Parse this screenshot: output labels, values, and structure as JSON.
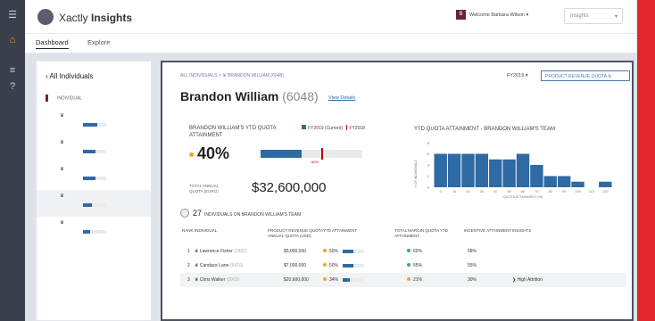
{
  "brand": {
    "name_plain": "Xactly ",
    "name_bold": "Insights"
  },
  "user": {
    "badge": "B",
    "welcome": "Welcome Barbara Wilson ▾"
  },
  "insights_select": {
    "value": "Insights"
  },
  "nav": {
    "tabs": [
      "Dashboard",
      "Explore"
    ]
  },
  "sidebar": {
    "back_label": "All Individuals",
    "header": "INDIVIDUAL",
    "items": [
      {
        "rank": "1",
        "name": "Lawrence Lane",
        "id": "(2001)",
        "pct": "60%",
        "progress": 0.6
      },
      {
        "rank": "2",
        "name": "Barry White",
        "id": "(2013)",
        "pct": "55%",
        "progress": 0.55
      },
      {
        "rank": "3",
        "name": "Crystal Edwards",
        "id": "(1110)",
        "pct": "55%",
        "progress": 0.55
      },
      {
        "rank": "4",
        "name": "Brandon William",
        "id": "(6048)",
        "pct": "40%",
        "progress": 0.4
      },
      {
        "rank": "5",
        "name": "Steve Edward",
        "id": "(2022)",
        "pct": "30%",
        "progress": 0.3
      }
    ]
  },
  "main": {
    "breadcrumb": "ALL INDIVIDUALS  >  ♛  BRANDON WILLIAM (6048)",
    "fy": "FY2019  ▾",
    "quota_button": "PRODUCT REVENUE QUOTA  ⇅",
    "name": "Brandon William ",
    "name_id": "(6048)",
    "view_details": "View Details",
    "attainment_title": "BRANDON WILLIAM'S YTD QUOTA ATTAINMENT",
    "legend_current": "FY2019 (Current)",
    "legend_prev": "FY2018",
    "attainment_value": "40%",
    "attainment_progress": 0.4,
    "target_label": "60%",
    "total_quota_label": "TOTAL ANNUAL QUOTA (EURO)",
    "total_quota_value": "$32,600,000",
    "team_chart_title": "YTD QUOTA ATTAINMENT - BRANDON WILLIAM'S TEAM",
    "hist_ylabel": "# OF INDIVIDUALS",
    "hist_xlabel": "QUOTA ATTAINMENT (%)",
    "people_count": "27",
    "people_label": "INDIVIDUALS ON BRANDON WILLIAM'S TEAM",
    "table": {
      "headers": [
        "RANK",
        "INDIVIDUAL",
        "PRODUCT REVENUE QUOTA  ANNUAL QUOTA (USD)",
        "YTD ATTAINMENT",
        "TOTAL MARGIN QUOTA  YTD ATTAINMENT",
        "INCENTIVE ATTAINMENT",
        "INSIGHTS"
      ],
      "rows": [
        {
          "rank": "1",
          "name": "Lawrence Fisher",
          "id": "(2402)",
          "quota": "$5,000,000",
          "att": "50%",
          "att_progress": 0.5,
          "margin": "60%",
          "incentive": "58%",
          "insight": ""
        },
        {
          "rank": "2",
          "name": "Candace Lane",
          "id": "(5410)",
          "quota": "$7,000,000",
          "att": "50%",
          "att_progress": 0.5,
          "margin": "55%",
          "incentive": "55%",
          "insight": ""
        },
        {
          "rank": "3",
          "name": "Chris Walker",
          "id": "(2903)",
          "quota": "$20,600,000",
          "att": "34%",
          "att_progress": 0.34,
          "margin": "21%",
          "incentive": "30%",
          "insight": "❯  High Attrition"
        }
      ]
    }
  },
  "chart_data": {
    "type": "bar",
    "title": "YTD QUOTA ATTAINMENT - BRANDON WILLIAM'S TEAM",
    "xlabel": "QUOTA ATTAINMENT (%)",
    "ylabel": "# OF INDIVIDUALS",
    "categories": [
      "0",
      "10",
      "20",
      "30",
      "40",
      "50",
      "60",
      "70",
      "80",
      "90",
      "100",
      "110",
      "120"
    ],
    "values": [
      6,
      6,
      6,
      6,
      5,
      5,
      6,
      4,
      2,
      2,
      1,
      0,
      1
    ],
    "ylim": [
      0,
      8
    ],
    "yticks": [
      "0",
      "2",
      "4",
      "6",
      "8"
    ],
    "colors": {
      "bar": "#2e6aa3"
    }
  }
}
